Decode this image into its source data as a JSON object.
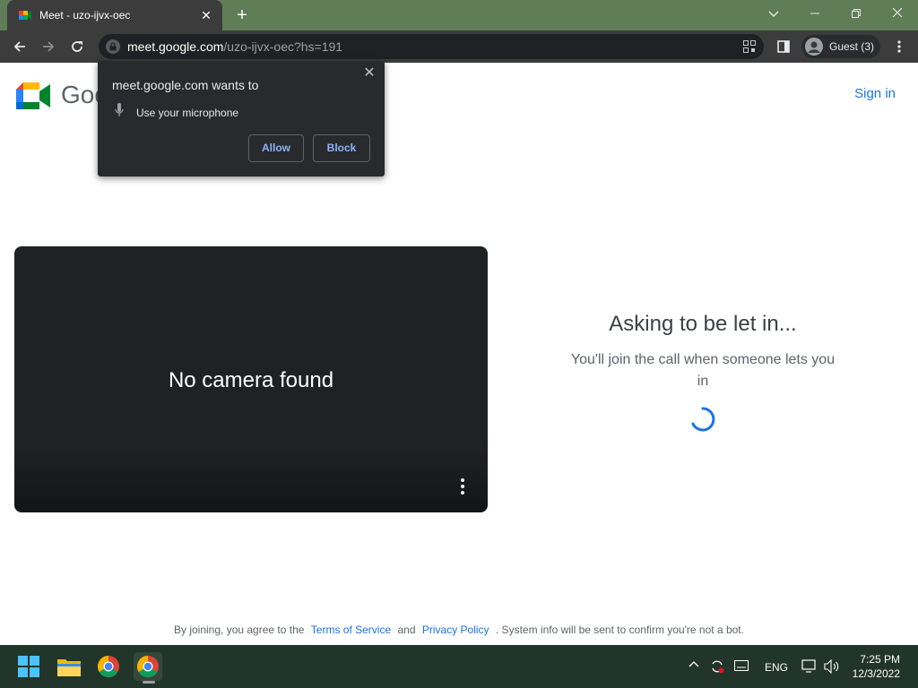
{
  "browser": {
    "tab_title": "Meet - uzo-ijvx-oec",
    "tab_close": "✕",
    "new_tab": "+",
    "url_host": "meet.google.com",
    "url_path": "/uzo-ijvx-oec?hs=191",
    "profile_label": "Guest (3)"
  },
  "page": {
    "brand_text": "Goo",
    "signin": "Sign in",
    "camera_message": "No camera found",
    "status_title": "Asking to be let in...",
    "status_subtitle": "You'll join the call when someone lets you in",
    "footer": {
      "prefix": "By joining, you agree to the",
      "terms": "Terms of Service",
      "and": "and",
      "privacy": "Privacy Policy",
      "suffix": ". System info will be sent to confirm you're not a bot."
    }
  },
  "permission_popup": {
    "title": "meet.google.com wants to",
    "request": "Use your microphone",
    "allow": "Allow",
    "block": "Block",
    "close": "✕"
  },
  "taskbar": {
    "language": "ENG",
    "time": "7:25 PM",
    "date": "12/3/2022"
  },
  "colors": {
    "titlebar": "#5f7e57",
    "toolbar": "#3c3c3c",
    "link": "#1a73e8",
    "popup_button_text": "#8ab4f8",
    "taskbar": "#22352a"
  },
  "icons": [
    "meet-favicon",
    "back-icon",
    "forward-icon",
    "reload-icon",
    "lock-icon",
    "qr-icon",
    "sidebar-icon",
    "avatar-icon",
    "menu-icon",
    "microphone-icon",
    "more-options-icon",
    "spinner-icon",
    "windows-start-icon",
    "file-explorer-icon",
    "chrome-icon",
    "chevron-up-icon",
    "sync-icon",
    "keyboard-icon",
    "network-icon",
    "volume-icon"
  ]
}
